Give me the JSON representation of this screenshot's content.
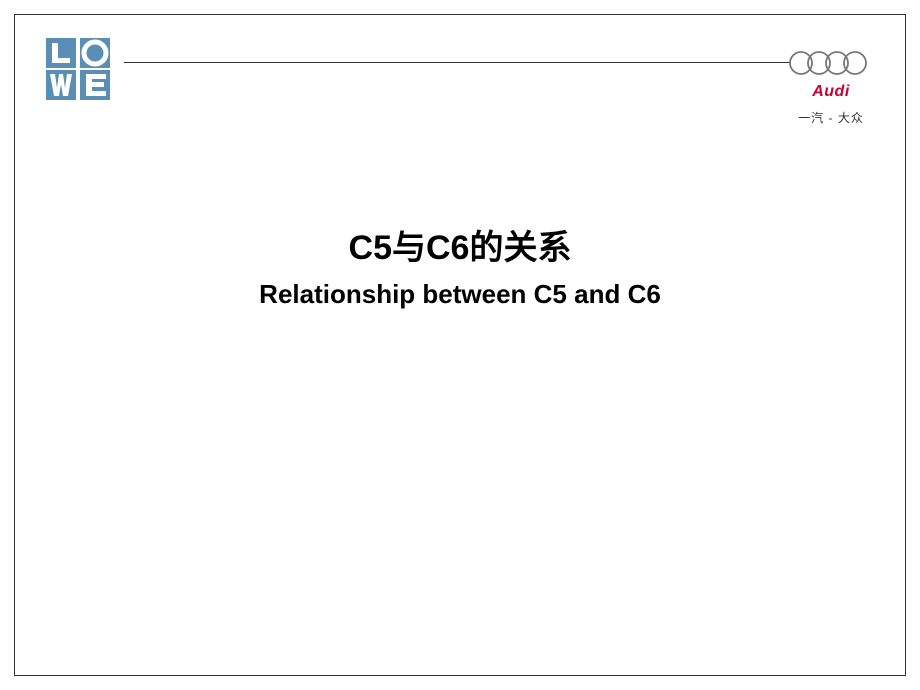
{
  "logos": {
    "lowe_name": "LOWE",
    "audi_label": "Audi",
    "faw_vw_label": "一汽 - 大众"
  },
  "title": {
    "chinese": "C5与C6的关系",
    "english": "Relationship between C5 and C6"
  }
}
